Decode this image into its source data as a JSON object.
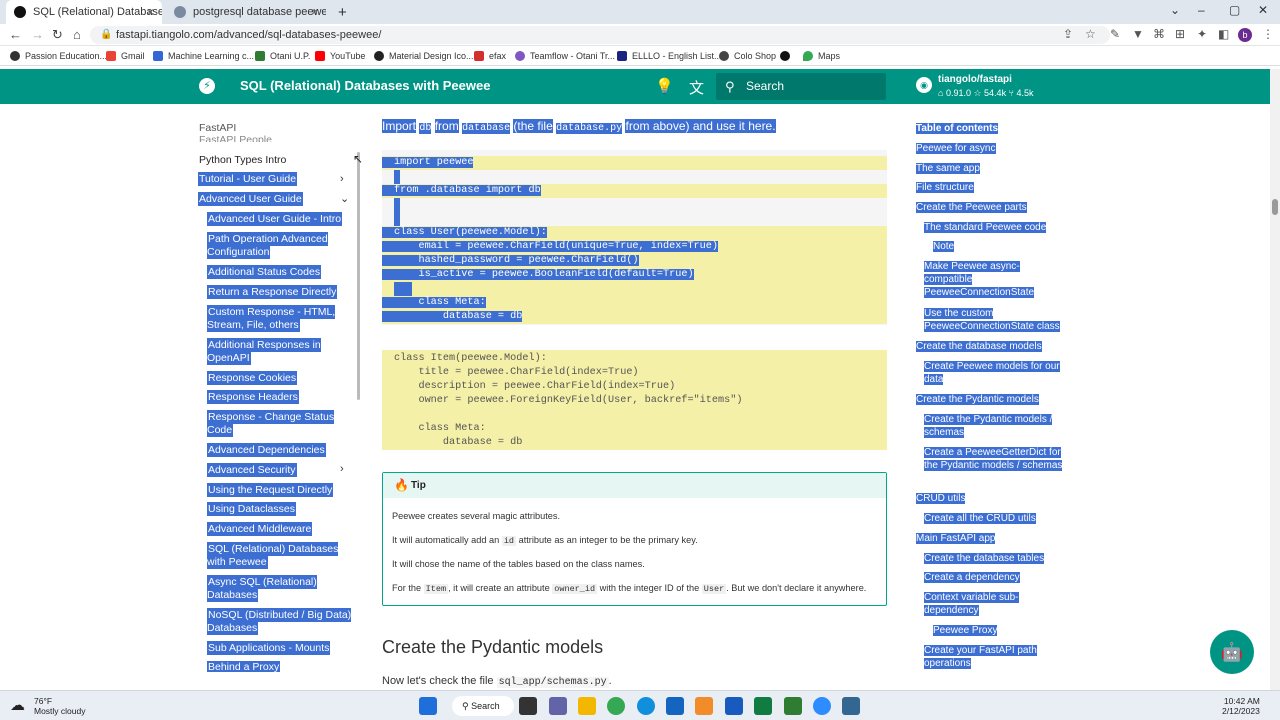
{
  "browser": {
    "tabs": [
      {
        "title": "SQL (Relational) Databases with P",
        "active": true
      },
      {
        "title": "postgresql database peewee - Tr",
        "active": false
      }
    ],
    "new_tab": "+",
    "url": "fastapi.tiangolo.com/advanced/sql-databases-peewee/",
    "bookmarks": [
      "Passion Education...",
      "Gmail",
      "Machine Learning c...",
      "Otani U.P.",
      "YouTube",
      "Material Design Ico...",
      "efax",
      "Teamflow - Otani Tr...",
      "ELLLO - English List...",
      "Colo Shop",
      "Maps"
    ],
    "profile_initial": "b"
  },
  "header": {
    "title": "SQL (Relational) Databases with Peewee",
    "search_placeholder": "Search",
    "repo_name": "tiangolo/fastapi",
    "repo_version": "0.91.0",
    "repo_stars": "54.4k",
    "repo_forks": "4.5k",
    "accent": "#009485"
  },
  "sidebar": {
    "items": [
      {
        "label": "FastAPI"
      },
      {
        "label": "FastAPI People"
      },
      {
        "label": "Python Types Intro"
      },
      {
        "label": "Tutorial - User Guide"
      },
      {
        "label": "Advanced User Guide"
      },
      {
        "label": "Advanced User Guide - Intro"
      },
      {
        "label": "Path Operation Advanced Configuration"
      },
      {
        "label": "Additional Status Codes"
      },
      {
        "label": "Return a Response Directly"
      },
      {
        "label": "Custom Response - HTML, Stream, File, others"
      },
      {
        "label": "Additional Responses in OpenAPI"
      },
      {
        "label": "Response Cookies"
      },
      {
        "label": "Response Headers"
      },
      {
        "label": "Response - Change Status Code"
      },
      {
        "label": "Advanced Dependencies"
      },
      {
        "label": "Advanced Security"
      },
      {
        "label": "Using the Request Directly"
      },
      {
        "label": "Using Dataclasses"
      },
      {
        "label": "Advanced Middleware"
      },
      {
        "label": "SQL (Relational) Databases with Peewee"
      },
      {
        "label": "Async SQL (Relational) Databases"
      },
      {
        "label": "NoSQL (Distributed / Big Data) Databases"
      },
      {
        "label": "Sub Applications - Mounts"
      },
      {
        "label": "Behind a Proxy"
      }
    ]
  },
  "content": {
    "intro_parts": [
      "Import",
      "db",
      "from",
      "database",
      "(the file",
      "database.py",
      "from above) and use it here."
    ],
    "code1": [
      "import peewee",
      "",
      "from .database import db",
      "",
      "",
      "class User(peewee.Model):",
      "    email = peewee.CharField(unique=True, index=True)",
      "    hashed_password = peewee.CharField()",
      "    is_active = peewee.BooleanField(default=True)",
      "",
      "    class Meta:",
      "        database = db"
    ],
    "code2": [
      "class Item(peewee.Model):",
      "    title = peewee.CharField(index=True)",
      "    description = peewee.CharField(index=True)",
      "    owner = peewee.ForeignKeyField(User, backref=\"items\")",
      "",
      "    class Meta:",
      "        database = db"
    ],
    "tip": {
      "title": "Tip",
      "p1": "Peewee creates several magic attributes.",
      "p2_a": "It will automatically add an",
      "p2_code": "id",
      "p2_b": "attribute as an integer to be the primary key.",
      "p3": "It will chose the name of the tables based on the class names.",
      "p4_a": "For the",
      "p4_code1": "Item",
      "p4_b": ", it will create an attribute",
      "p4_code2": "owner_id",
      "p4_c": "with the integer ID of the",
      "p4_code3": "User",
      "p4_d": ". But we don't declare it anywhere."
    },
    "h2": "Create the Pydantic models",
    "para_a": "Now let's check the file",
    "para_code": "sql_app/schemas.py",
    "para_b": "."
  },
  "toc": {
    "items": [
      {
        "label": "Table of contents"
      },
      {
        "label": "Peewee for async"
      },
      {
        "label": "The same app"
      },
      {
        "label": "File structure"
      },
      {
        "label": "Create the Peewee parts"
      },
      {
        "label": "The standard Peewee code"
      },
      {
        "label": "Note"
      },
      {
        "label": "Make Peewee async-compatible PeeweeConnectionState"
      },
      {
        "label": "Use the custom PeeweeConnectionState class"
      },
      {
        "label": "Create the database models"
      },
      {
        "label": "Create Peewee models for our data"
      },
      {
        "label": "Create the Pydantic models"
      },
      {
        "label": "Create the Pydantic models / schemas"
      },
      {
        "label": "Create a PeeweeGetterDict for the Pydantic models / schemas"
      },
      {
        "label": "CRUD utils"
      },
      {
        "label": "Create all the CRUD utils"
      },
      {
        "label": "Main FastAPI app"
      },
      {
        "label": "Create the database tables"
      },
      {
        "label": "Create a dependency"
      },
      {
        "label": "Context variable sub-dependency"
      },
      {
        "label": "Peewee Proxy"
      },
      {
        "label": "Create your FastAPI path operations"
      }
    ]
  },
  "taskbar": {
    "temp": "76°F",
    "weather": "Mostly cloudy",
    "search": "Search",
    "time": "10:42 AM",
    "date": "2/12/2023"
  }
}
